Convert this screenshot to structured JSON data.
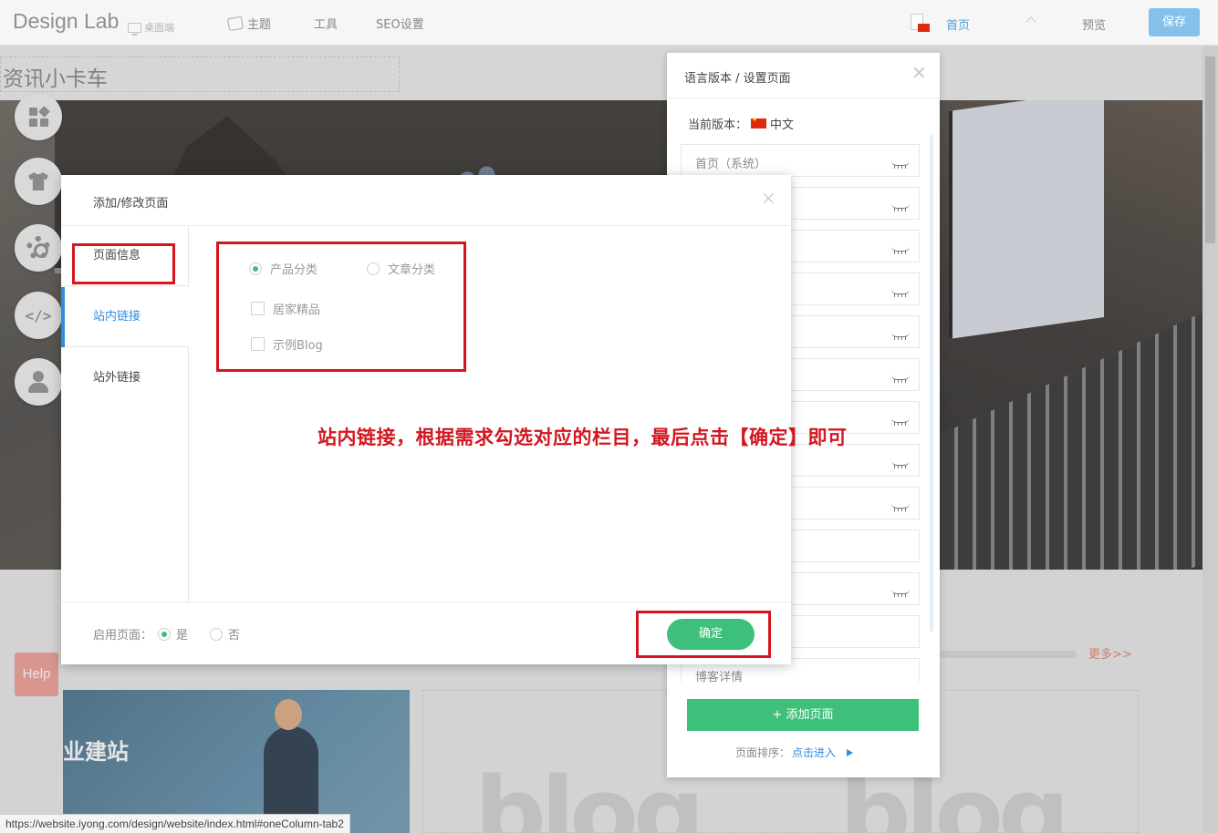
{
  "topbar": {
    "brand": "Design Lab",
    "device": "桌面端",
    "nav": {
      "theme": "主题",
      "tools": "工具",
      "seo": "SEO设置"
    },
    "current_page": "首页",
    "preview": "预览",
    "save": "保存"
  },
  "site": {
    "title": "资讯小卡车",
    "help": "Help",
    "more": "更多>>",
    "banner_text": "业建站",
    "blog_word": "blog"
  },
  "icons": {
    "tool_widgets": "widgets-icon",
    "tool_theme": "shirt-icon",
    "tool_settings": "gear-icon",
    "tool_code": "code-icon",
    "tool_user": "user-icon",
    "code_glyph": "</>",
    "close_glyph": "×"
  },
  "language_panel": {
    "title": "语言版本 / 设置页面",
    "current_version_label": "当前版本：",
    "current_version": "中文",
    "pages": [
      {
        "label": "首页（系统）"
      },
      {
        "label": ""
      },
      {
        "label": ""
      },
      {
        "label": ""
      },
      {
        "label": ""
      },
      {
        "label": ""
      },
      {
        "label": ""
      },
      {
        "label": ""
      },
      {
        "label": ""
      },
      {
        "label": ""
      },
      {
        "label": ""
      },
      {
        "label": ""
      },
      {
        "label": "博客详情"
      }
    ],
    "add_page": "+ 添加页面",
    "sort_label": "页面排序：",
    "sort_link": "点击进入"
  },
  "modal": {
    "title": "添加/修改页面",
    "tabs": {
      "page_info": "页面信息",
      "internal_link": "站内链接",
      "external_link": "站外链接"
    },
    "radio_product": "产品分类",
    "radio_article": "文章分类",
    "check_1": "居家精品",
    "check_2": "示例Blog",
    "annotation": "站内链接，根据需求勾选对应的栏目，最后点击【确定】即可",
    "enable_label": "启用页面：",
    "enable_yes": "是",
    "enable_no": "否",
    "confirm": "确定"
  },
  "status_url": "https://website.iyong.com/design/website/index.html#oneColumn-tab2",
  "colors": {
    "accent_green": "#3fc07a",
    "accent_blue": "#2f8ce0",
    "annotation_red": "#d4161f"
  }
}
